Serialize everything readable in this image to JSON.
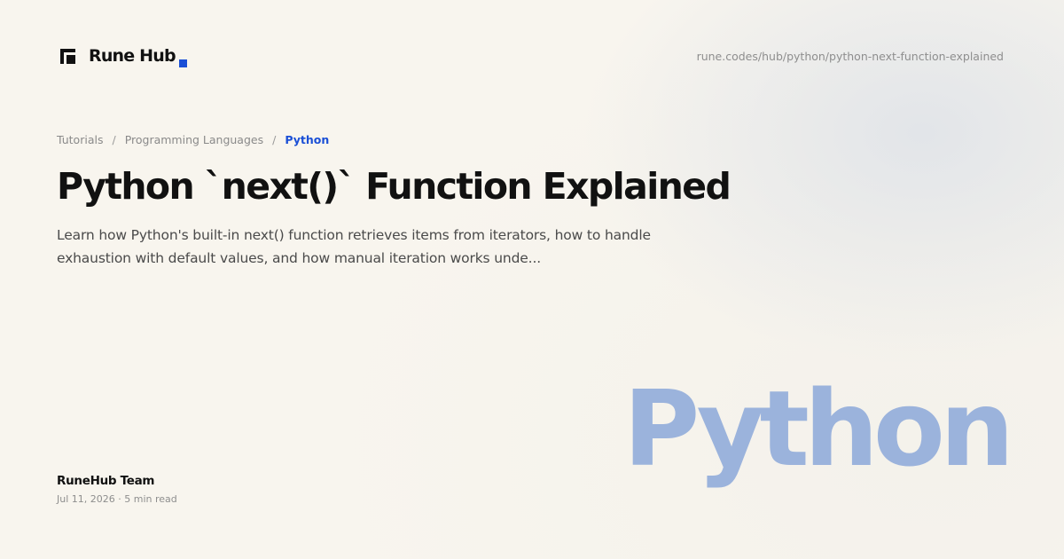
{
  "brand": {
    "name": "Rune Hub",
    "accent_color": "#1a4fd6",
    "logo_icon": "rune-hub-logo-icon"
  },
  "url": "rune.codes/hub/python/python-next-function-explained",
  "breadcrumb": {
    "items": [
      "Tutorials",
      "Programming Languages"
    ],
    "separator": "/",
    "current": "Python"
  },
  "article": {
    "title": "Python `next()` Function Explained",
    "description": "Learn how Python's built-in next() function retrieves items from iterators, how to handle exhaustion with default values, and how manual iteration works unde...",
    "author": "RuneHub Team",
    "date": "Jul 11, 2026",
    "meta_separator": "·",
    "read_time": "5 min read"
  },
  "category_word": "Python",
  "colors": {
    "background": "#f8f5ee",
    "category_word": "#9bb3dc",
    "text": "#111111",
    "muted": "#8e8e8e"
  }
}
